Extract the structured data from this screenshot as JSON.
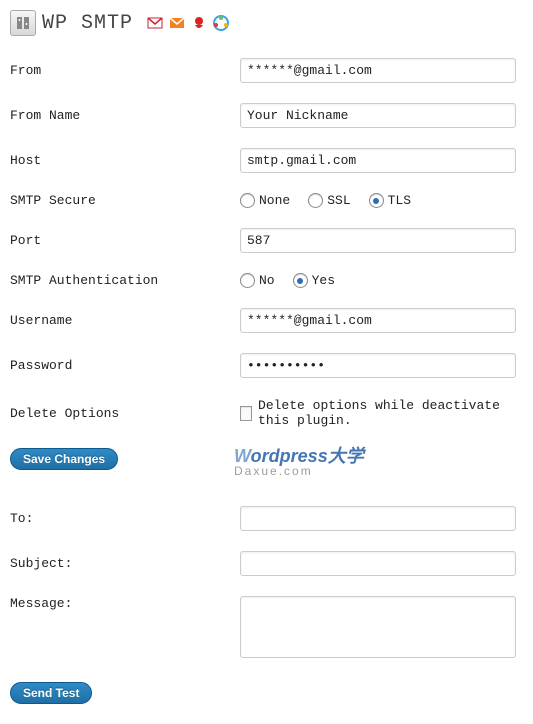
{
  "header": {
    "title": "WP SMTP"
  },
  "fields": {
    "from": {
      "label": "From",
      "value": "******@gmail.com"
    },
    "from_name": {
      "label": "From Name",
      "value": "Your Nickname"
    },
    "host": {
      "label": "Host",
      "value": "smtp.gmail.com"
    },
    "smtp_secure": {
      "label": "SMTP Secure",
      "options": {
        "none": "None",
        "ssl": "SSL",
        "tls": "TLS"
      },
      "selected": "tls"
    },
    "port": {
      "label": "Port",
      "value": "587"
    },
    "smtp_auth": {
      "label": "SMTP Authentication",
      "options": {
        "no": "No",
        "yes": "Yes"
      },
      "selected": "yes"
    },
    "username": {
      "label": "Username",
      "value": "******@gmail.com"
    },
    "password": {
      "label": "Password",
      "value": "••••••••••"
    },
    "delete_options": {
      "label": "Delete Options",
      "checkbox_label": "Delete options while deactivate this plugin.",
      "checked": false
    }
  },
  "buttons": {
    "save": "Save Changes",
    "send_test": "Send Test"
  },
  "watermark": {
    "line1a": "W",
    "line1b": "ordpress大学",
    "line2": "Daxue.com"
  },
  "test": {
    "to": {
      "label": "To:",
      "value": ""
    },
    "subject": {
      "label": "Subject:",
      "value": ""
    },
    "message": {
      "label": "Message:",
      "value": ""
    }
  }
}
